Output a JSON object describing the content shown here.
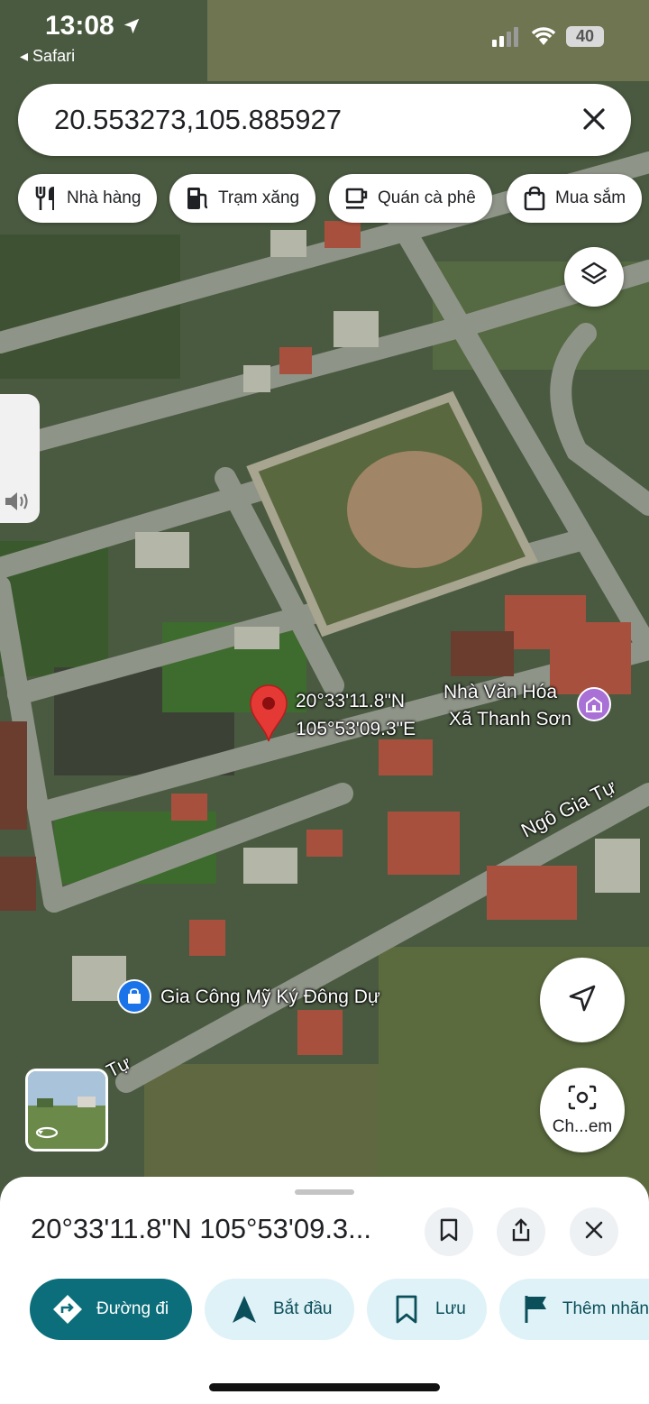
{
  "status_bar": {
    "time": "13:08",
    "back_app": "Safari",
    "battery": "40"
  },
  "search": {
    "value": "20.553273,105.885927"
  },
  "chips": [
    {
      "label": "Nhà hàng",
      "icon": "restaurant-icon"
    },
    {
      "label": "Trạm xăng",
      "icon": "gas-station-icon"
    },
    {
      "label": "Quán cà phê",
      "icon": "coffee-icon"
    },
    {
      "label": "Mua sắm",
      "icon": "shopping-bag-icon"
    }
  ],
  "map": {
    "pin_label_lat": "20°33'11.8\"N",
    "pin_label_lng": "105°53'09.3\"E",
    "poi_culture_line1": "Nhà Văn Hóa",
    "poi_culture_line2": "Xã Thanh Sơn",
    "street_1": "Ngô Gia Tự",
    "street_2": "Tự",
    "poi_shop": "Gia Công Mỹ Ký Đông Dự",
    "camera_label": "Ch...em"
  },
  "sheet": {
    "title": "20°33'11.8\"N 105°53'09.3...",
    "actions": [
      {
        "label": "Đường đi",
        "icon": "directions-icon"
      },
      {
        "label": "Bắt đầu",
        "icon": "navigation-arrow-icon"
      },
      {
        "label": "Lưu",
        "icon": "bookmark-icon"
      },
      {
        "label": "Thêm nhãn",
        "icon": "flag-icon"
      }
    ]
  },
  "colors": {
    "accent_teal": "#0b6e7a",
    "chip_light": "#dff2f7",
    "pin_red": "#e53935"
  }
}
